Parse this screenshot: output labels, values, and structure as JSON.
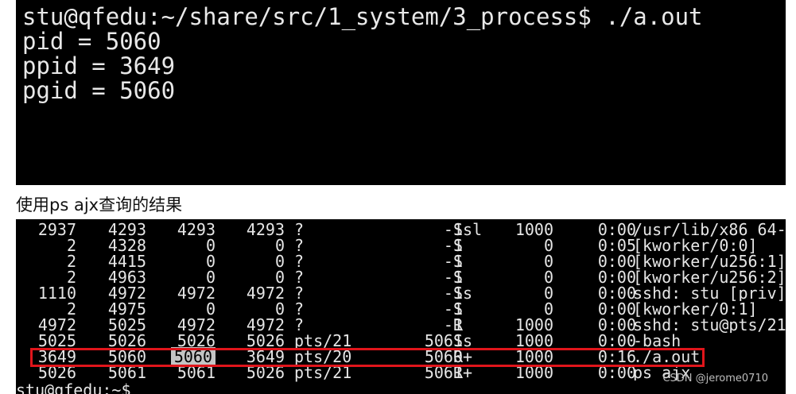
{
  "top_terminal": {
    "lines": [
      "stu@qfedu:~/share/src/1_system/3_process$ ./a.out",
      "pid = 5060",
      "ppid = 3649",
      "pgid = 5060"
    ]
  },
  "caption": "使用ps ajx查询的结果",
  "ps_output": {
    "partial_top_line": "/usr/lib/x86_64",
    "rows": [
      {
        "ppid": "2937",
        "pid": "4293",
        "pgid": "4293",
        "sid": "4293",
        "tty": "?",
        "tpgid": "-1",
        "stat": "Ssl",
        "uid": "1000",
        "time": "0:00",
        "command": "/usr/lib/x86_64-"
      },
      {
        "ppid": "2",
        "pid": "4328",
        "pgid": "0",
        "sid": "0",
        "tty": "?",
        "tpgid": "-1",
        "stat": "S",
        "uid": "0",
        "time": "0:05",
        "command": "[kworker/0:0]"
      },
      {
        "ppid": "2",
        "pid": "4415",
        "pgid": "0",
        "sid": "0",
        "tty": "?",
        "tpgid": "-1",
        "stat": "S",
        "uid": "0",
        "time": "0:00",
        "command": "[kworker/u256:1]"
      },
      {
        "ppid": "2",
        "pid": "4963",
        "pgid": "0",
        "sid": "0",
        "tty": "?",
        "tpgid": "-1",
        "stat": "S",
        "uid": "0",
        "time": "0:00",
        "command": "[kworker/u256:2]"
      },
      {
        "ppid": "1110",
        "pid": "4972",
        "pgid": "4972",
        "sid": "4972",
        "tty": "?",
        "tpgid": "-1",
        "stat": "Ss",
        "uid": "0",
        "time": "0:00",
        "command": "sshd: stu [priv]"
      },
      {
        "ppid": "2",
        "pid": "4975",
        "pgid": "0",
        "sid": "0",
        "tty": "?",
        "tpgid": "-1",
        "stat": "S",
        "uid": "0",
        "time": "0:00",
        "command": "[kworker/0:1]"
      },
      {
        "ppid": "4972",
        "pid": "5025",
        "pgid": "4972",
        "sid": "4972",
        "tty": "?",
        "tpgid": "-1",
        "stat": "R",
        "uid": "1000",
        "time": "0:00",
        "command": "sshd: stu@pts/21"
      },
      {
        "ppid": "5025",
        "pid": "5026",
        "pgid": "5026",
        "sid": "5026",
        "tty": "pts/21",
        "tpgid": "5061",
        "stat": "Ss",
        "uid": "1000",
        "time": "0:00",
        "command": "-bash"
      },
      {
        "ppid": "3649",
        "pid": "5060",
        "pgid": "5060",
        "sid": "3649",
        "tty": "pts/20",
        "tpgid": "5060",
        "stat": "R+",
        "uid": "1000",
        "time": "0:16",
        "command": "./a.out"
      },
      {
        "ppid": "5026",
        "pid": "5061",
        "pgid": "5061",
        "sid": "5026",
        "tty": "pts/21",
        "tpgid": "5061",
        "stat": "R+",
        "uid": "1000",
        "time": "0:00",
        "command": "ps ajx"
      }
    ],
    "prompt_partial": "stu@qfedu:~$",
    "highlighted_row_index": 8,
    "highlighted_cell": "pgid",
    "highlight_color": "#e0151b"
  },
  "watermark": "CSDN @jerome0710"
}
